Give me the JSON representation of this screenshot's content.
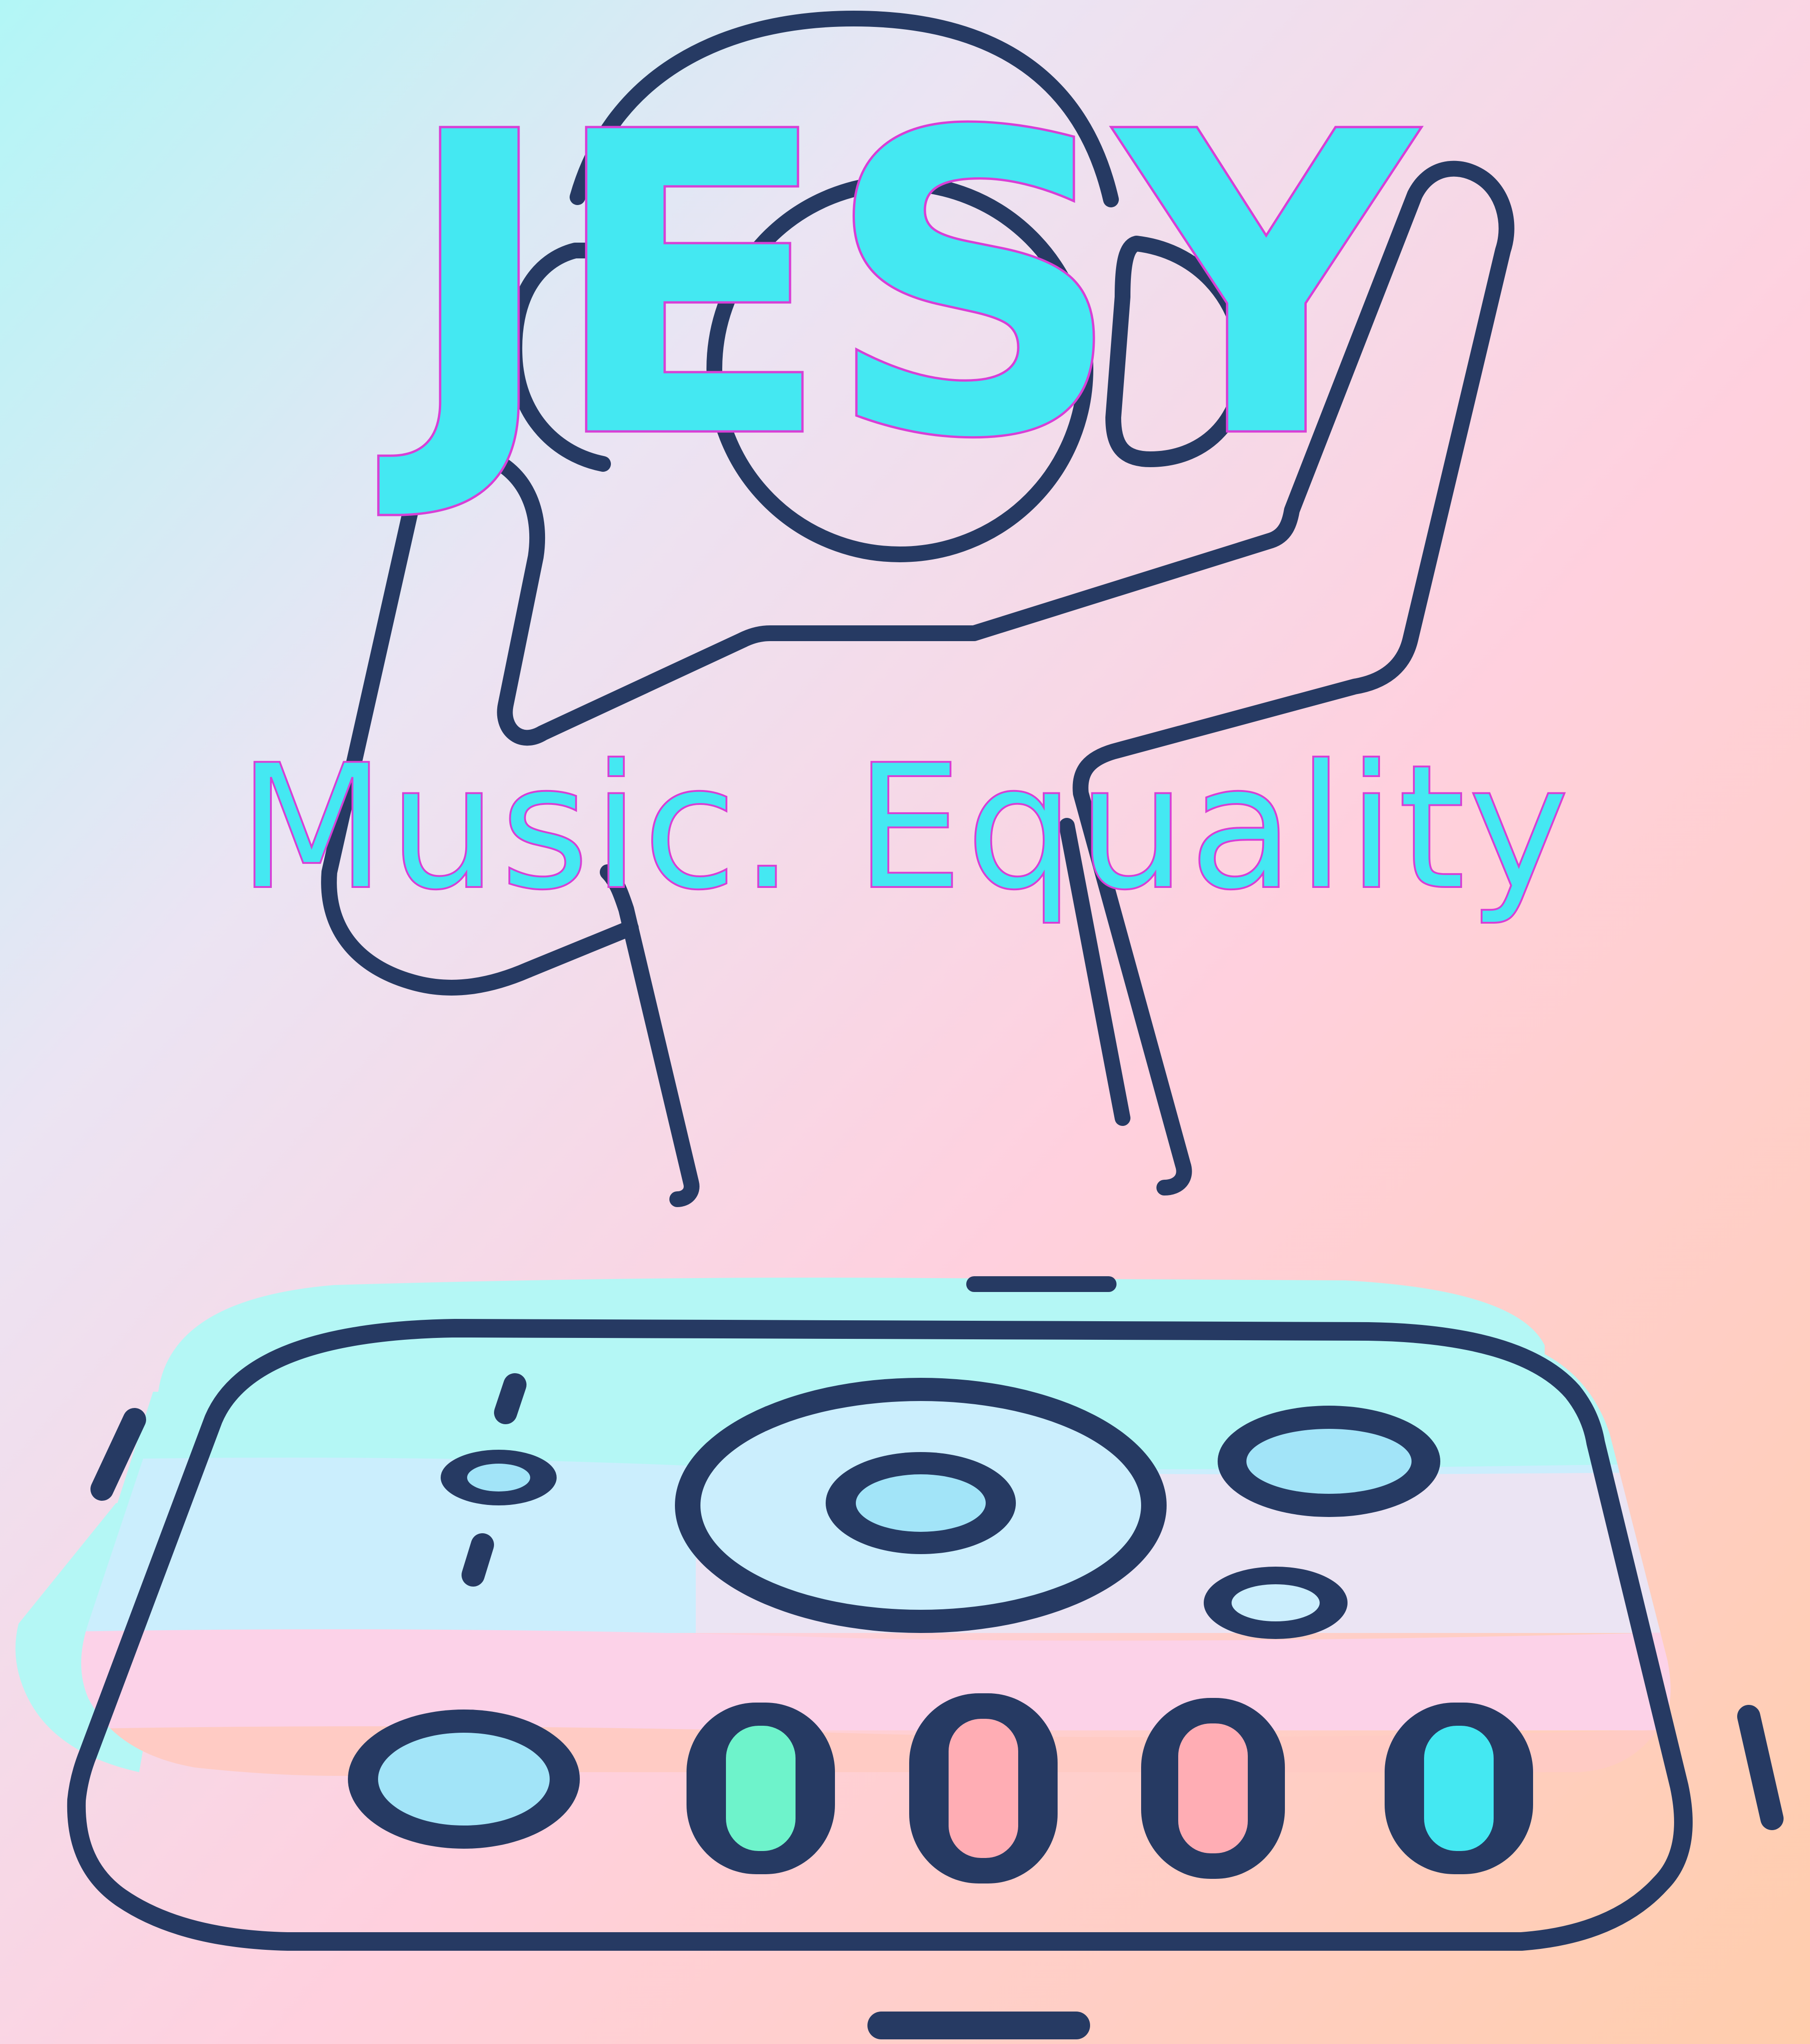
{
  "poster": {
    "title": "JESY",
    "tagline": "Music. Equality"
  },
  "illustration": {
    "subject": "dj-with-headphones-and-mixer",
    "icons": [
      "headphones-icon",
      "dj-mixer-icon"
    ]
  },
  "colors": {
    "background_top_left": "#b2f6f6",
    "background_mid": "#ebe4f3",
    "background_pink": "#ffd0de",
    "background_bottom_right": "#ffcdac",
    "outline": "#263a63",
    "title_fill": "#44e8f2",
    "title_stroke": "#d83fd6",
    "mixer_cyan": "#b4f7f5",
    "mixer_light_blue": "#cbeefd",
    "mixer_pink": "#fcd2e8",
    "mixer_peach": "#ffcba1",
    "knob_fill": "#a2e4f8",
    "pad_green": "#6ef3cb",
    "pad_pink": "#ffadb4",
    "pad_cyan": "#44e8f2"
  }
}
